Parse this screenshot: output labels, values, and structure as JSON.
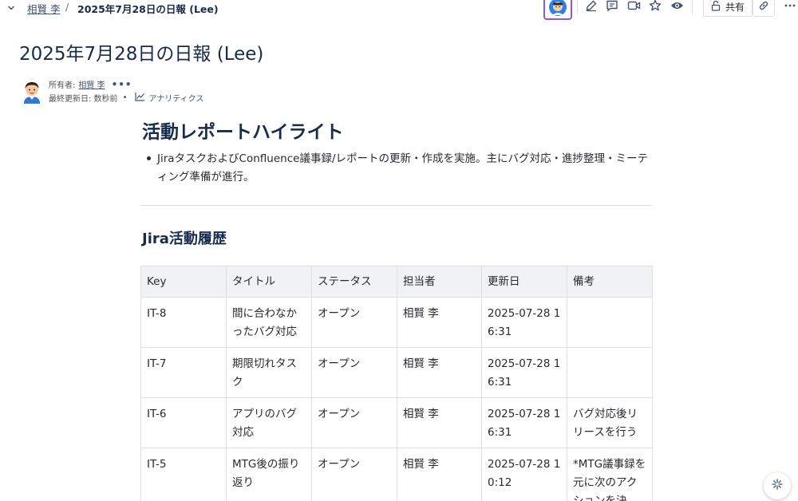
{
  "breadcrumb": {
    "parent": "相賢 李",
    "separator": "/",
    "current": "2025年7月28日の日報 (Lee)"
  },
  "toolbar": {
    "share_label": "共有",
    "icons": [
      "edit-icon",
      "comment-icon",
      "video-icon",
      "star-icon",
      "watch-icon",
      "lock-icon",
      "link-icon",
      "more-icon"
    ]
  },
  "page": {
    "title": "2025年7月28日の日報 (Lee)",
    "owner_label": "所有者:",
    "owner_name": "相賢 李",
    "owner_more": "•••",
    "updated": "最終更新日: 数秒前",
    "dot": "•",
    "analytics": "アナリティクス"
  },
  "content": {
    "heading1": "活動レポートハイライト",
    "bullet": "JiraタスクおよびConfluence議事録/レポートの更新・作成を実施。主にバグ対応・進捗整理・ミーティング準備が進行。",
    "heading2": "Jira活動履歴"
  },
  "table": {
    "headers": [
      "Key",
      "タイトル",
      "ステータス",
      "担当者",
      "更新日",
      "備考"
    ],
    "rows": [
      [
        "IT-8",
        "間に合わなかったバグ対応",
        "オープン",
        "相賢 李",
        "2025-07-28 16:31",
        ""
      ],
      [
        "IT-7",
        "期限切れタスク",
        "オープン",
        "相賢 李",
        "2025-07-28 16:31",
        ""
      ],
      [
        "IT-6",
        "アプリのバグ対応",
        "オープン",
        "相賢 李",
        "2025-07-28 16:31",
        "バグ対応後リリースを行う"
      ],
      [
        "IT-5",
        "MTG後の振り返り",
        "オープン",
        "相賢 李",
        "2025-07-28 10:12",
        "*MTG議事録を元に次のアクションを決"
      ]
    ]
  },
  "colors": {
    "accent": "#8f56e8",
    "table_header_bg": "#f1f2f4",
    "text": "#292a2e"
  }
}
